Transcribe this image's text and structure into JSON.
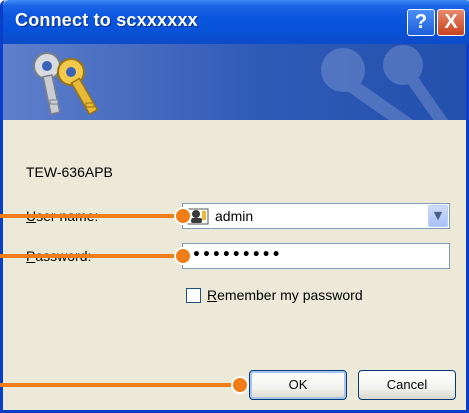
{
  "window": {
    "title": "Connect to scxxxxxx",
    "help_glyph": "?",
    "close_glyph": "X"
  },
  "banner": {
    "icon": "keys-icon"
  },
  "form": {
    "server_name": "TEW-636APB",
    "username_label_hotkey": "U",
    "username_label_rest": "ser name:",
    "username_value": "admin",
    "password_label_hotkey": "P",
    "password_label_rest": "assword:",
    "password_value": "•••••••••",
    "remember_hotkey": "R",
    "remember_rest": "emember my password",
    "remember_checked": false
  },
  "buttons": {
    "ok": "OK",
    "cancel": "Cancel"
  },
  "colors": {
    "titlebar": "#0a56de",
    "dialog_bg": "#ece9d8",
    "callout": "#f07d18"
  }
}
